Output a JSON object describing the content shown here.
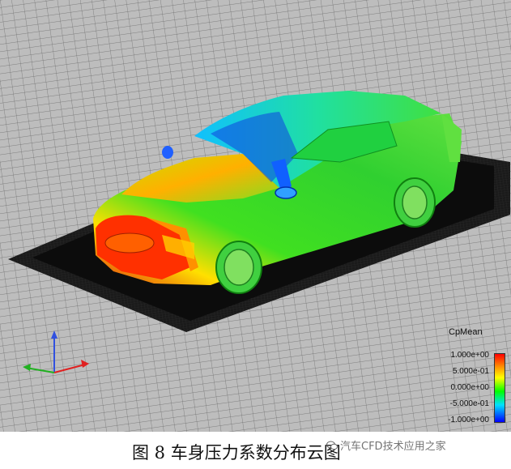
{
  "legend": {
    "title": "CpMean",
    "ticks": [
      "1.000e+00",
      "5.000e-01",
      "0.000e+00",
      "-5.000e-01",
      "-1.000e+00"
    ],
    "colors": [
      "#ff0000",
      "#ffff00",
      "#00ff00",
      "#00e0ff",
      "#0000ff"
    ],
    "min": -1.0,
    "max": 1.0
  },
  "caption": {
    "text": "图 8  车身压力系数分布云图"
  },
  "watermark": {
    "text": "汽车CFD技术应用之家",
    "icon": "wechat-icon"
  },
  "axes": {
    "icon": "coordinate-axes-icon",
    "colors": [
      "#e02020",
      "#20b020",
      "#3050e0"
    ]
  }
}
